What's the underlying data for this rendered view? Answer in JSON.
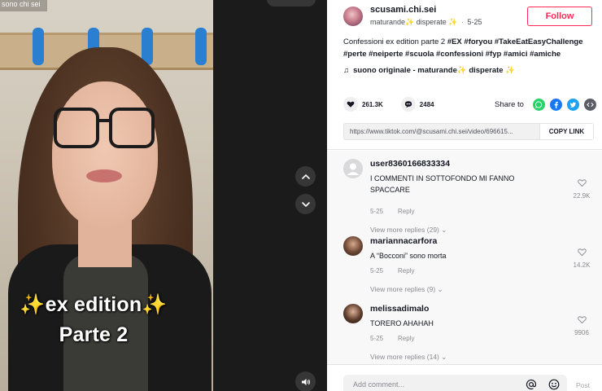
{
  "video": {
    "top_left_text": "sono chi sei",
    "caption_line1": "✨ex edition✨",
    "caption_line2": "Parte 2"
  },
  "author": {
    "username": "scusami.chi.sei",
    "nickname": "maturande✨ disperate ✨",
    "separator": "·",
    "date": "5-25",
    "follow_label": "Follow"
  },
  "post": {
    "description_plain": "Confessioni ex edition parte 2 ",
    "hashtags": "#EX #foryou #TakeEatEasyChallenge #perte #neiperte #scuola #confessioni #fyp #amici #amiche",
    "music_note": "♫",
    "music": "suono originale - maturande✨ disperate ✨",
    "likes": "261.3K",
    "comments": "2484",
    "share_label": "Share to",
    "link_url": "https://www.tiktok.com/@scusami.chi.sei/video/696615...",
    "copy_link_label": "COPY LINK"
  },
  "comments": [
    {
      "user": "user8360166833334",
      "text": "I COMMENTI IN SOTTOFONDO MI FANNO SPACCARE",
      "date": "5-25",
      "reply_label": "Reply",
      "likes": "22.9K",
      "replies": "View more replies (29)"
    },
    {
      "user": "mariannacarfora",
      "text": "A “Bocconi” sono morta",
      "date": "5-25",
      "reply_label": "Reply",
      "likes": "14.2K",
      "replies": "View more replies (9)"
    },
    {
      "user": "melissadimalo",
      "text": "TORERO AHAHAH",
      "date": "5-25",
      "reply_label": "Reply",
      "likes": "9906",
      "replies": "View more replies (14)"
    }
  ],
  "composer": {
    "placeholder": "Add comment...",
    "post_label": "Post"
  },
  "colors": {
    "accent": "#fe2c55",
    "whatsapp": "#25d366",
    "facebook": "#1877f2",
    "twitter": "#1da1f2",
    "embed": "#5c5e66"
  },
  "icons": [
    "chevron-up-icon",
    "chevron-down-icon",
    "volume-icon",
    "heart-icon",
    "comment-icon",
    "whatsapp-icon",
    "facebook-icon",
    "twitter-icon",
    "embed-icon",
    "at-icon",
    "emoji-icon"
  ]
}
